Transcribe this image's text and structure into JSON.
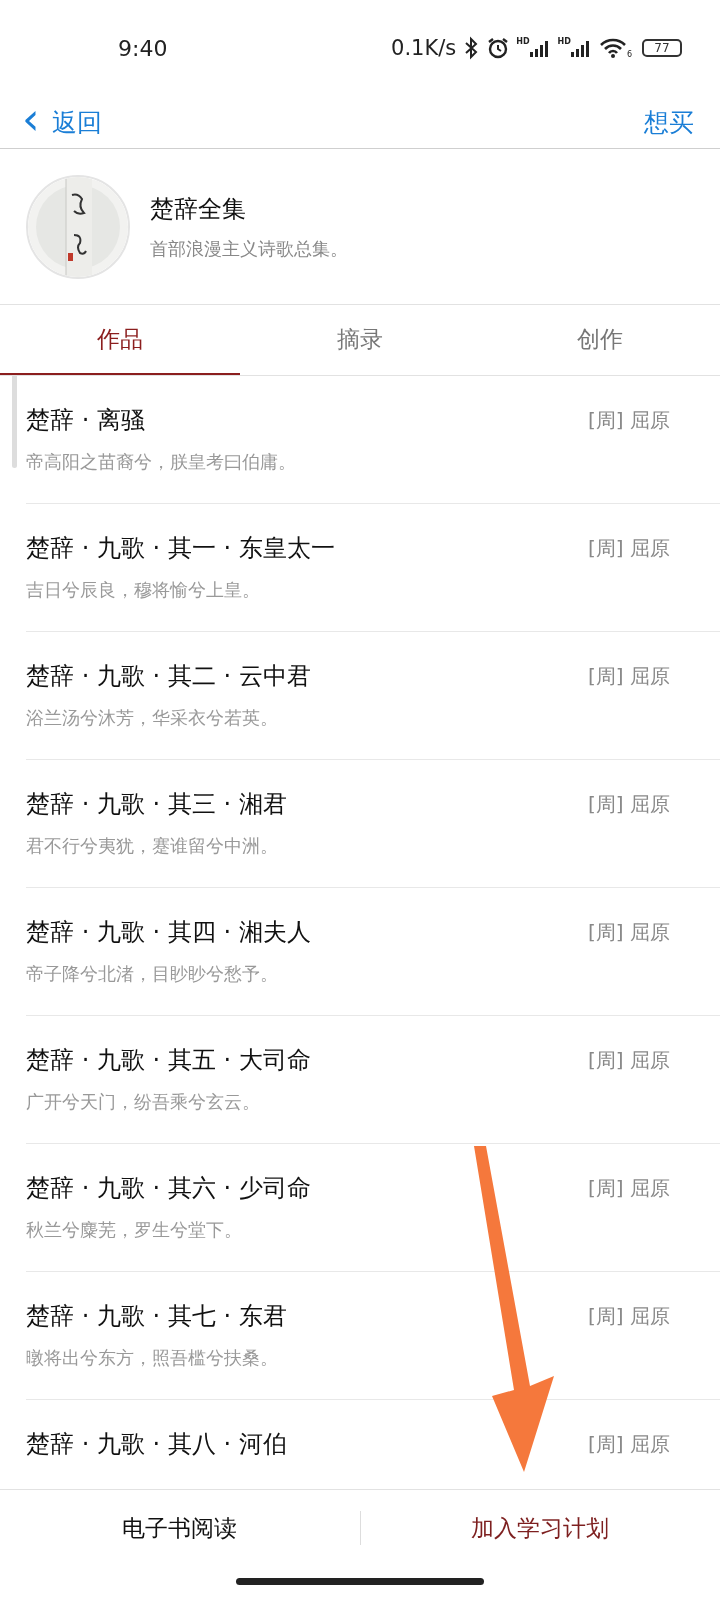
{
  "status_bar": {
    "time": "9:40",
    "speed": "0.1K/s",
    "signals": [
      {
        "label": "HD"
      },
      {
        "label": "HD"
      }
    ],
    "wifi_label": "6",
    "battery": "77"
  },
  "nav": {
    "back_icon": "‹",
    "back": "返回",
    "action": "想买"
  },
  "book": {
    "title": "楚辞全集",
    "subtitle": "首部浪漫主义诗歌总集。"
  },
  "tabs": [
    {
      "label": "作品",
      "selected": true
    },
    {
      "label": "摘录",
      "selected": false
    },
    {
      "label": "创作",
      "selected": false
    }
  ],
  "works": [
    {
      "title": "楚辞 · 离骚",
      "author": "[周] 屈原",
      "excerpt": "帝高阳之苗裔兮，朕皇考曰伯庸。"
    },
    {
      "title": "楚辞 · 九歌 · 其一 · 东皇太一",
      "author": "[周] 屈原",
      "excerpt": "吉日兮辰良，穆将愉兮上皇。"
    },
    {
      "title": "楚辞 · 九歌 · 其二 · 云中君",
      "author": "[周] 屈原",
      "excerpt": "浴兰汤兮沐芳，华采衣兮若英。"
    },
    {
      "title": "楚辞 · 九歌 · 其三 · 湘君",
      "author": "[周] 屈原",
      "excerpt": "君不行兮夷犹，蹇谁留兮中洲。"
    },
    {
      "title": "楚辞 · 九歌 · 其四 · 湘夫人",
      "author": "[周] 屈原",
      "excerpt": "帝子降兮北渚，目眇眇兮愁予。"
    },
    {
      "title": "楚辞 · 九歌 · 其五 · 大司命",
      "author": "[周] 屈原",
      "excerpt": "广开兮天门，纷吾乘兮玄云。"
    },
    {
      "title": "楚辞 · 九歌 · 其六 · 少司命",
      "author": "[周] 屈原",
      "excerpt": "秋兰兮麋芜，罗生兮堂下。"
    },
    {
      "title": "楚辞 · 九歌 · 其七 · 东君",
      "author": "[周] 屈原",
      "excerpt": "暾将出兮东方，照吾槛兮扶桑。"
    },
    {
      "title": "楚辞 · 九歌 · 其八 · 河伯",
      "author": "[周] 屈原"
    }
  ],
  "bottom_bar": {
    "buttons": [
      {
        "label": "电子书阅读",
        "kind": "plain"
      },
      {
        "label": "加入学习计划",
        "kind": "accent"
      }
    ]
  }
}
